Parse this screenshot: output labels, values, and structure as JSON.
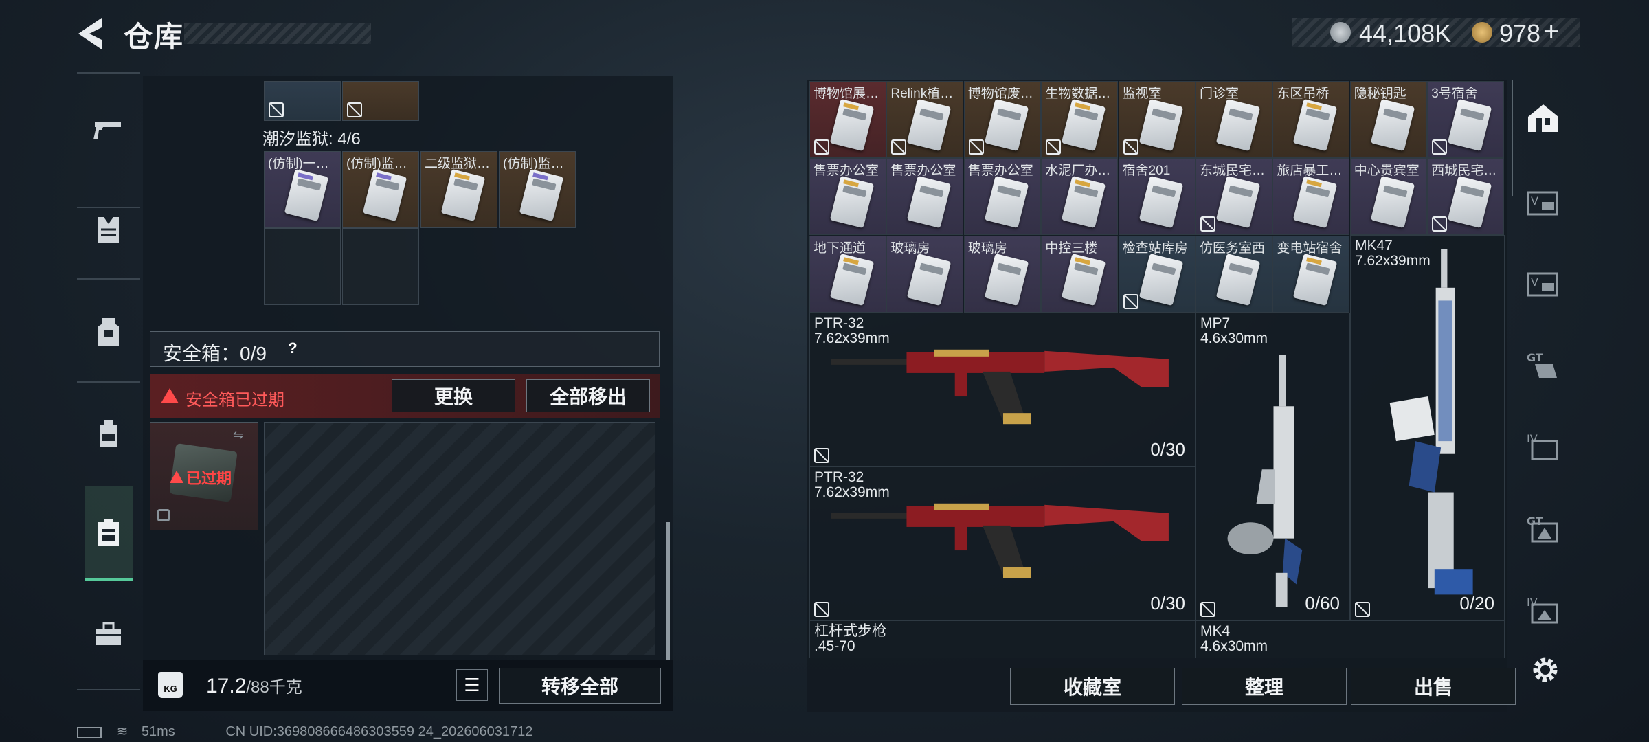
{
  "title": "仓库",
  "currency": [
    {
      "icon": "silver-coin-icon",
      "value": "44,108K"
    },
    {
      "icon": "gold-coin-icon",
      "value": "978"
    },
    {
      "icon": "add-icon",
      "value": "+"
    }
  ],
  "left_nav": {
    "icons": [
      "pistol-icon",
      "vest-icon",
      "backpack-armor-icon",
      "bag-icon",
      "safebox-icon",
      "toolbox-icon"
    ],
    "active": "safebox-icon"
  },
  "tide_prison": {
    "label": "潮汐监狱: 4/6",
    "cards": [
      "(仿制)一…",
      "(仿制)监…",
      "二级监狱…",
      "(仿制)监…"
    ]
  },
  "safebox": {
    "label": "安全箱：0/9",
    "help": "?",
    "expired_msg": "安全箱已过期",
    "replace": "更换",
    "move_all_out": "全部移出",
    "box_status": "已过期"
  },
  "weight": {
    "value": "17.2",
    "unit": "/88千克",
    "kg": "KG",
    "transfer_all": "转移全部"
  },
  "cards_row1": [
    "博物馆展…",
    "Relink植…",
    "博物馆废…",
    "生物数据…",
    "监视室",
    "门诊室",
    "东区吊桥",
    "隐秘钥匙",
    "3号宿舍"
  ],
  "cards_row2": [
    "售票办公室",
    "售票办公室",
    "售票办公室",
    "水泥厂办…",
    "宿舍201",
    "东城民宅…",
    "旅店暴工…",
    "中心贵宾室",
    "西城民宅…"
  ],
  "cards_row3": [
    "地下通道",
    "玻璃房",
    "玻璃房",
    "中控三楼",
    "检查站库房",
    "仿医务室西",
    "变电站宿舍"
  ],
  "weapons": [
    {
      "name": "PTR-32",
      "caliber": "7.62x39mm",
      "ammo": "0/30"
    },
    {
      "name": "PTR-32",
      "caliber": "7.62x39mm",
      "ammo": "0/30"
    },
    {
      "name": "MP7",
      "caliber": "4.6x30mm",
      "ammo": "0/60"
    },
    {
      "name": "MK47",
      "caliber": "7.62x39mm",
      "ammo": "0/20"
    },
    {
      "name": "杠杆式步枪",
      "caliber": ".45-70",
      "ammo": ""
    },
    {
      "name": "MK4",
      "caliber": "4.6x30mm",
      "ammo": ""
    }
  ],
  "bottom_buttons": {
    "collection": "收藏室",
    "organize": "整理",
    "sell": "出售"
  },
  "right_nav": [
    "house-icon",
    "v-card-icon",
    "v-card-icon-2",
    "gtl-card-icon",
    "iv-folder-icon",
    "gti-card-icon",
    "iv-card-icon",
    "settings-gear-icon"
  ],
  "status": {
    "ping": "51ms",
    "uid": "CN UID:369808666486303559 24_202606031712"
  }
}
